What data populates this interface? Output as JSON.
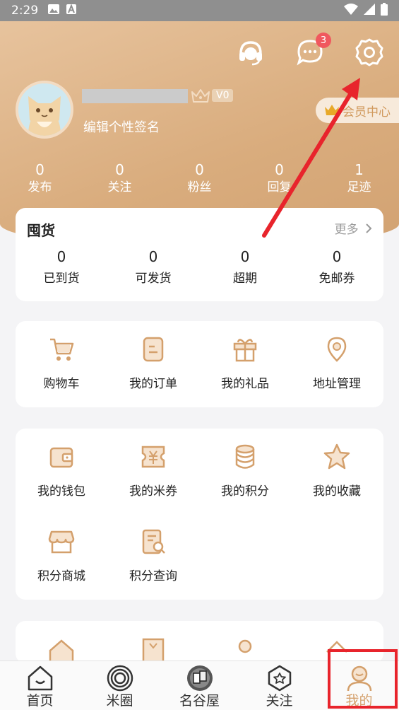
{
  "status_bar": {
    "time": "2:29"
  },
  "header": {
    "signature": "编辑个性签名",
    "vip_level": "V0",
    "member_center": "会员中心",
    "messages_badge": "3",
    "stats": [
      {
        "num": "0",
        "label": "发布"
      },
      {
        "num": "0",
        "label": "关注"
      },
      {
        "num": "0",
        "label": "粉丝"
      },
      {
        "num": "0",
        "label": "回复"
      },
      {
        "num": "1",
        "label": "足迹"
      }
    ]
  },
  "hoard": {
    "title": "囤货",
    "more": "更多",
    "items": [
      {
        "num": "0",
        "label": "已到货"
      },
      {
        "num": "0",
        "label": "可发货"
      },
      {
        "num": "0",
        "label": "超期"
      },
      {
        "num": "0",
        "label": "免邮券"
      }
    ]
  },
  "orders_section": {
    "items": [
      {
        "label": "购物车",
        "icon": "cart-icon"
      },
      {
        "label": "我的订单",
        "icon": "order-icon"
      },
      {
        "label": "我的礼品",
        "icon": "gift-icon"
      },
      {
        "label": "地址管理",
        "icon": "location-icon"
      }
    ]
  },
  "wallet_section": {
    "items": [
      {
        "label": "我的钱包",
        "icon": "wallet-icon"
      },
      {
        "label": "我的米券",
        "icon": "coupon-icon"
      },
      {
        "label": "我的积分",
        "icon": "points-icon"
      },
      {
        "label": "我的收藏",
        "icon": "star-icon"
      },
      {
        "label": "积分商城",
        "icon": "shop-icon"
      },
      {
        "label": "积分查询",
        "icon": "query-icon"
      }
    ]
  },
  "tabbar": {
    "tabs": [
      {
        "label": "首页",
        "icon": "home-icon"
      },
      {
        "label": "米圈",
        "icon": "circle-icon"
      },
      {
        "label": "名谷屋",
        "icon": "valley-icon"
      },
      {
        "label": "关注",
        "icon": "follow-icon"
      },
      {
        "label": "我的",
        "icon": "profile-icon"
      }
    ],
    "active_index": 4
  },
  "colors": {
    "accent": "#d4a06c",
    "header": "#d9ac7d",
    "annotation": "#e8242c"
  }
}
